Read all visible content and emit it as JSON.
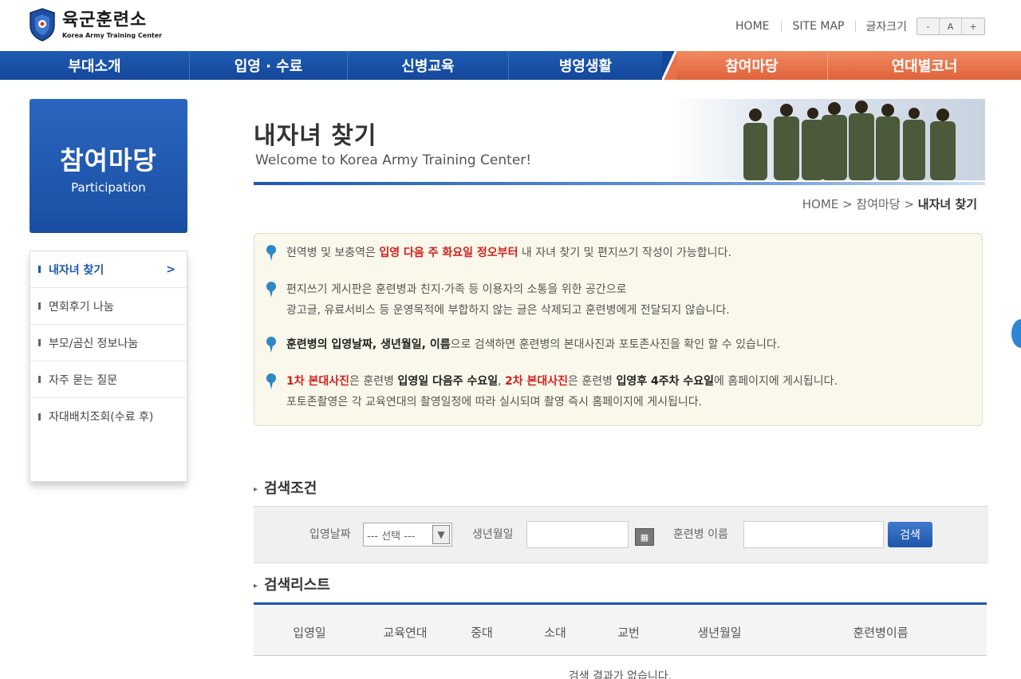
{
  "header": {
    "logo_ko": "육군훈련소",
    "logo_en": "Korea Army Training Center",
    "util_home": "HOME",
    "util_sitemap": "SITE MAP",
    "font_size_label": "글자크기",
    "font_minus": "-",
    "font_reset": "A",
    "font_plus": "+"
  },
  "nav": {
    "items": [
      "부대소개",
      "입영 · 수료",
      "신병교육",
      "병영생활",
      "참여마당",
      "연대별코너"
    ],
    "active": "참여마당",
    "active_color": "#e56a40",
    "primary_color": "#1a52a8"
  },
  "sidebar": {
    "title_ko": "참여마당",
    "title_en": "Participation",
    "items": [
      "내자녀 찾기",
      "면회후기 나눔",
      "부모/곰신 정보나눔",
      "자주 묻는 질문",
      "자대배치조회(수료 후)"
    ],
    "active_arrow": ">"
  },
  "page": {
    "title": "내자녀 찾기",
    "subtitle": "Welcome to Korea Army Training Center!",
    "breadcrumb_home": "HOME",
    "breadcrumb_sep": ">",
    "breadcrumb_section": "참여마당",
    "breadcrumb_current": "내자녀 찾기"
  },
  "notice": {
    "line1_a": "현역병 및 보충역은 ",
    "line1_red": "입영 다음 주 화요일 정오부터",
    "line1_b": " 내 자녀 찾기 및 편지쓰기 작성이 가능합니다.",
    "line2_a": "편지쓰기 게시판은 훈련병과 친지·가족 등 이용자의 소통을 위한 공간으로",
    "line2_b": "광고글, 유료서비스 등 운영목적에 부합하지 않는 글은 삭제되고 훈련병에게 전달되지 않습니다.",
    "line3_bold": "훈련병의 입영날짜, 생년월일, 이름",
    "line3_b": "으로 검색하면 훈련병의 본대사진과 포토존사진을 확인 할 수 있습니다.",
    "line4_red1": "1차 본대사진",
    "line4_a": "은 훈련병 ",
    "line4_bold1": "입영일 다음주 수요일",
    "line4_b": ", ",
    "line4_red2": "2차 본대사진",
    "line4_c": "은 훈련병 ",
    "line4_bold2": "입영후 4주차 수요일",
    "line4_d": "에 홈페이지에 게시됩니다.",
    "line5": "포토존촬영은 각 교육연대의 촬영일정에 따라 실시되며 촬영 즉시 홈페이지에 게시됩니다."
  },
  "search": {
    "section_title": "검색조건",
    "date_label": "입영날짜",
    "date_selected": "--- 선택 ---",
    "birth_label": "생년월일",
    "birth_value": "",
    "name_label": "훈련병 이름",
    "name_value": "",
    "button": "검색"
  },
  "results": {
    "section_title": "검색리스트",
    "columns": [
      "입영일",
      "교육연대",
      "중대",
      "소대",
      "교번",
      "생년월일",
      "훈련병이름"
    ],
    "empty_message": "검색 결과가 없습니다."
  }
}
